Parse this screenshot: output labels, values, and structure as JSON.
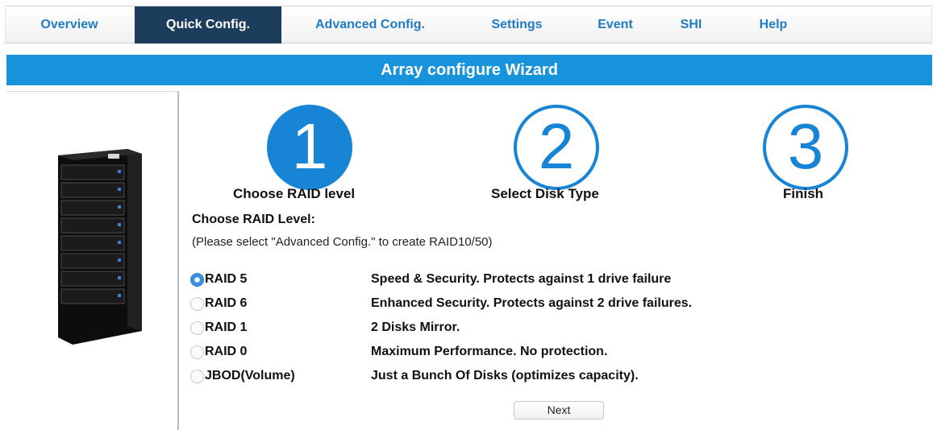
{
  "tabs": [
    {
      "label": "Overview",
      "active": false
    },
    {
      "label": "Quick Config.",
      "active": true
    },
    {
      "label": "Advanced Config.",
      "active": false
    },
    {
      "label": "Settings",
      "active": false
    },
    {
      "label": "Event",
      "active": false
    },
    {
      "label": "SHI",
      "active": false
    },
    {
      "label": "Help",
      "active": false
    }
  ],
  "banner": {
    "title": "Array configure Wizard"
  },
  "steps": [
    {
      "number": "1",
      "label": "Choose RAID level",
      "state": "current"
    },
    {
      "number": "2",
      "label": "Select Disk Type",
      "state": "pending"
    },
    {
      "number": "3",
      "label": "Finish",
      "state": "pending"
    }
  ],
  "section": {
    "title": "Choose RAID Level:",
    "note": "(Please select \"Advanced Config.\" to create RAID10/50)"
  },
  "options": [
    {
      "label": "RAID 5",
      "description": "Speed & Security. Protects against 1 drive failure",
      "selected": true
    },
    {
      "label": "RAID 6",
      "description": "Enhanced Security. Protects against 2 drive failures.",
      "selected": false
    },
    {
      "label": "RAID 1",
      "description": "2 Disks Mirror.",
      "selected": false
    },
    {
      "label": "RAID 0",
      "description": "Maximum Performance. No protection.",
      "selected": false
    },
    {
      "label": "JBOD(Volume)",
      "description": "Just a Bunch Of Disks (optimizes capacity).",
      "selected": false
    }
  ],
  "next_button": {
    "label": "Next"
  },
  "colors": {
    "accent": "#1784d6",
    "banner": "#1793dc",
    "active_tab": "#1d3d5c",
    "tab_text": "#1f7bc6"
  },
  "icons": {
    "device": "raid-enclosure-image"
  }
}
